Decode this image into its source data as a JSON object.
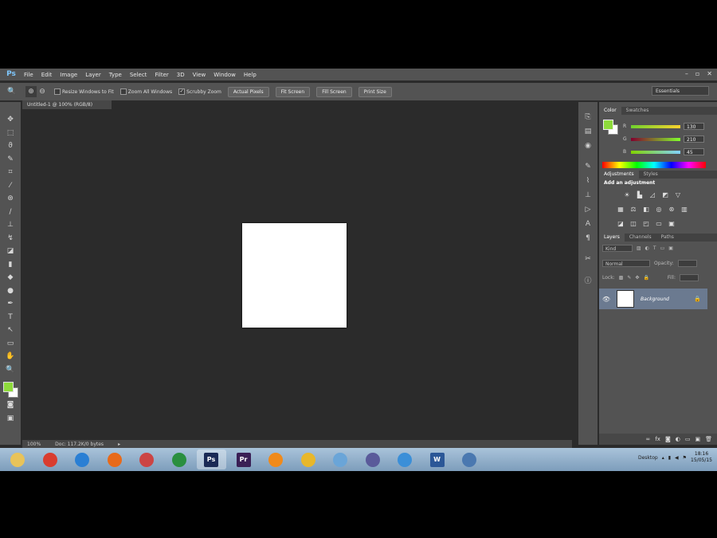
{
  "menubar": {
    "logo": "Ps",
    "items": [
      "File",
      "Edit",
      "Image",
      "Layer",
      "Type",
      "Select",
      "Filter",
      "3D",
      "View",
      "Window",
      "Help"
    ],
    "window_controls": [
      "–",
      "▫",
      "✕"
    ]
  },
  "options": {
    "checks": [
      {
        "label": "Resize Windows to Fit",
        "checked": false
      },
      {
        "label": "Zoom All Windows",
        "checked": false
      },
      {
        "label": "Scrubby Zoom",
        "checked": true
      }
    ],
    "buttons": [
      "Actual Pixels",
      "Fit Screen",
      "Fill Screen",
      "Print Size"
    ],
    "workspace": "Essentials"
  },
  "document": {
    "tab_title": "Untitled-1 @ 100% (RGB/8)",
    "status_zoom": "100%",
    "status_doc": "Doc: 117.2K/0 bytes"
  },
  "color_panel": {
    "tabs": [
      "Color",
      "Swatches"
    ],
    "sliders": [
      {
        "letter": "R",
        "value": "130"
      },
      {
        "letter": "G",
        "value": "210"
      },
      {
        "letter": "B",
        "value": "45"
      }
    ],
    "fg_color": "#8edb3b"
  },
  "adjustments_panel": {
    "tabs": [
      "Adjustments",
      "Styles"
    ],
    "title": "Add an adjustment"
  },
  "layers_panel": {
    "tabs": [
      "Layers",
      "Channels",
      "Paths"
    ],
    "kind": "Kind",
    "blend_mode": "Normal",
    "opacity_label": "Opacity:",
    "lock_label": "Lock:",
    "fill_label": "Fill:",
    "layer_name": "Background"
  },
  "taskbar": {
    "apps": [
      {
        "name": "folder",
        "color": "#e8c35a"
      },
      {
        "name": "chrome",
        "color": "#d93c2f"
      },
      {
        "name": "internet-explorer",
        "color": "#2a7fd4"
      },
      {
        "name": "firefox",
        "color": "#e86a1a"
      },
      {
        "name": "app-5",
        "color": "#c44"
      },
      {
        "name": "app-6",
        "color": "#2a8f3f"
      },
      {
        "name": "photoshop",
        "color": "#1a2a55",
        "label": "Ps"
      },
      {
        "name": "premiere",
        "color": "#3a1f55",
        "label": "Pr"
      },
      {
        "name": "vlc",
        "color": "#f08a1a"
      },
      {
        "name": "player",
        "color": "#e8b72a"
      },
      {
        "name": "app-11",
        "color": "#6aa5d8"
      },
      {
        "name": "app-12",
        "color": "#5a5a9a"
      },
      {
        "name": "app-13",
        "color": "#3b8fd8"
      },
      {
        "name": "word",
        "color": "#2b5797",
        "label": "W"
      },
      {
        "name": "app-15",
        "color": "#4a78b0"
      }
    ],
    "tray_label": "Desktop",
    "time": "18:16",
    "date": "15/05/15"
  }
}
